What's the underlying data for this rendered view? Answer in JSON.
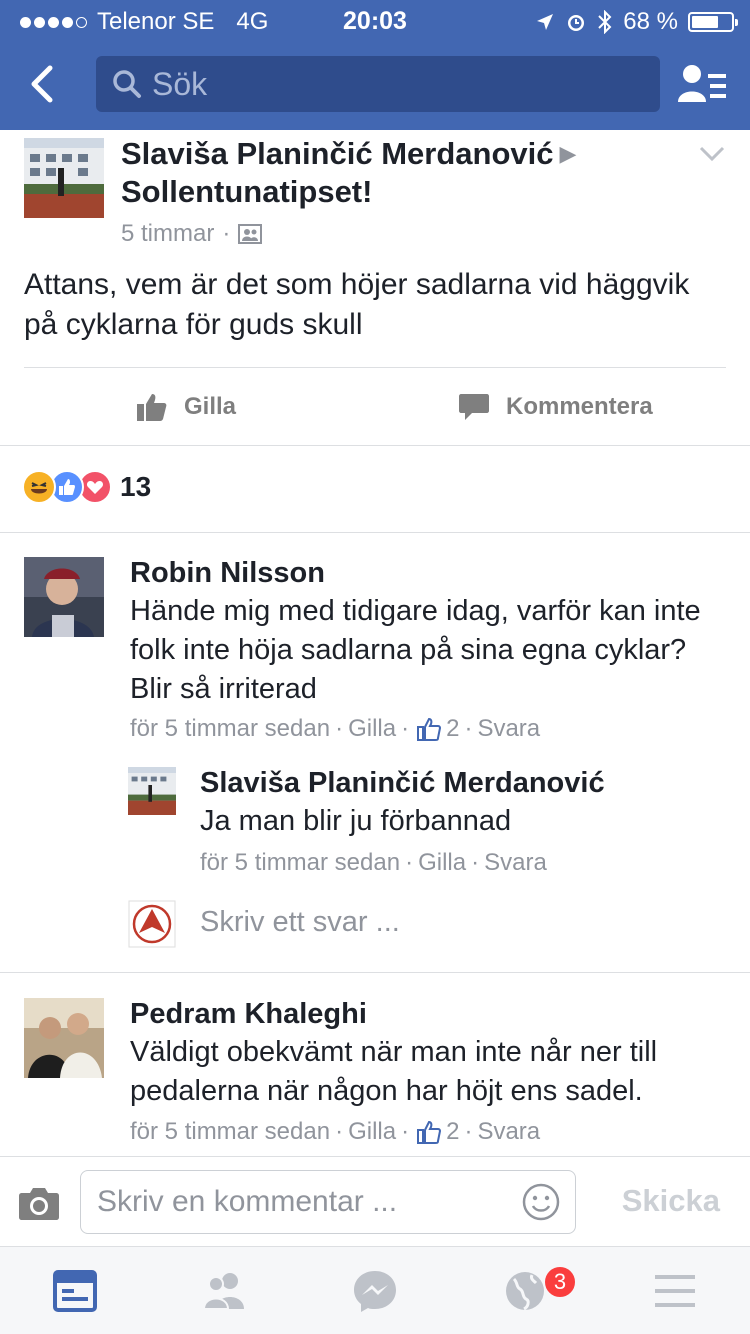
{
  "status_bar": {
    "carrier": "Telenor SE",
    "network": "4G",
    "time": "20:03",
    "battery": "68 %",
    "battery_level": 0.68,
    "signal_bars": 4
  },
  "nav": {
    "search_placeholder": "Sök",
    "icons": [
      "back-arrow-icon",
      "search-icon",
      "friend-requests-icon"
    ]
  },
  "post": {
    "author": "Slaviša Planinčić Merdanović",
    "target": "Sollentunatipset!",
    "time": "5 timmar",
    "privacy_icon": "group-icon",
    "text": "Attans, vem är det som höjer sadlarna vid häggvik på cyklarna för guds skull",
    "actions": {
      "like": "Gilla",
      "comment": "Kommentera"
    },
    "reactions": {
      "types": [
        "haha",
        "like",
        "love"
      ],
      "count": "13"
    }
  },
  "comments": [
    {
      "author": "Robin Nilsson",
      "text": "Hände mig med tidigare idag, varför kan inte folk inte höja sadlarna på sina egna cyklar? Blir så irriterad",
      "time": "för 5 timmar sedan",
      "like_label": "Gilla",
      "likes": "2",
      "reply_label": "Svara",
      "replies": [
        {
          "author": "Slaviša Planinčić Merdanović",
          "text": "Ja man blir ju förbannad",
          "time": "för 5 timmar sedan",
          "like_label": "Gilla",
          "reply_label": "Svara"
        }
      ],
      "reply_placeholder": "Skriv ett svar ..."
    },
    {
      "author": "Pedram Khaleghi",
      "text": "Väldigt obekvämt när man inte når ner till pedalerna när någon har höjt ens sadel.",
      "time": "för 5 timmar sedan",
      "like_label": "Gilla",
      "likes": "2",
      "reply_label": "Svara"
    }
  ],
  "composer": {
    "placeholder": "Skriv en kommentar ...",
    "send_label": "Skicka"
  },
  "tab_bar": {
    "tabs": [
      "news-feed",
      "friend-requests",
      "messenger",
      "notifications",
      "menu"
    ],
    "notifications_badge": "3"
  },
  "colors": {
    "brand": "#4267b2",
    "brand_dark": "#2f4c8c",
    "text": "#1d2129",
    "meta": "#90949c",
    "badge": "#fa3e3e"
  }
}
